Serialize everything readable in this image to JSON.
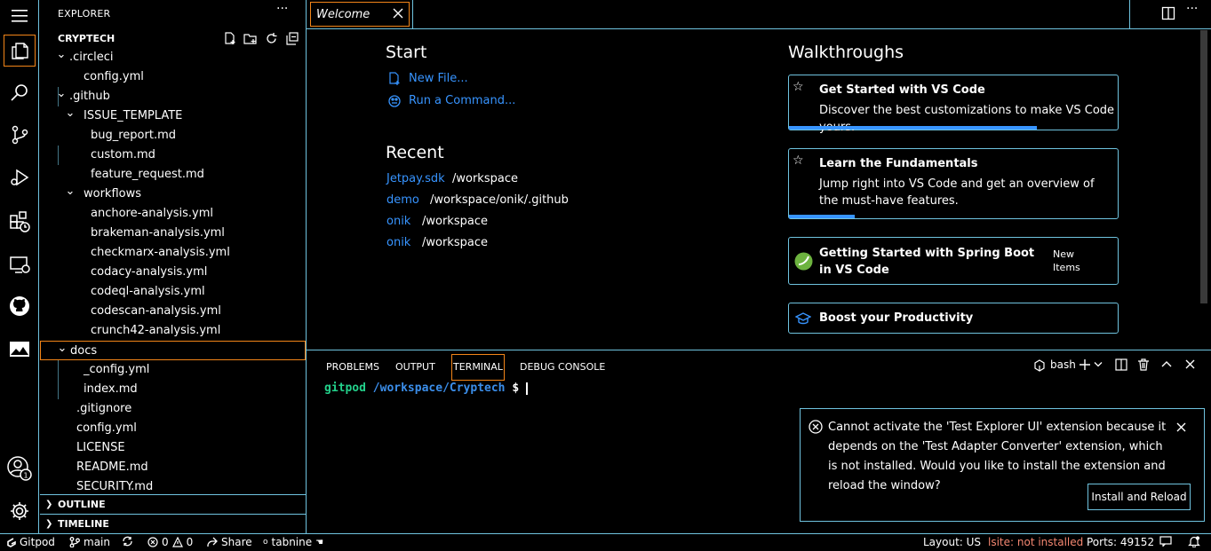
{
  "sidebar": {
    "title": "EXPLORER",
    "more": "···",
    "root": "CRYPTECH",
    "tree": [
      {
        "label": ".circleci",
        "type": "folder"
      },
      {
        "label": "config.yml",
        "type": "file"
      },
      {
        "label": ".github",
        "type": "folder"
      },
      {
        "label": "ISSUE_TEMPLATE",
        "type": "folder"
      },
      {
        "label": "bug_report.md",
        "type": "file"
      },
      {
        "label": "custom.md",
        "type": "file"
      },
      {
        "label": "feature_request.md",
        "type": "file"
      },
      {
        "label": "workflows",
        "type": "folder"
      },
      {
        "label": "anchore-analysis.yml",
        "type": "file"
      },
      {
        "label": "brakeman-analysis.yml",
        "type": "file"
      },
      {
        "label": "checkmarx-analysis.yml",
        "type": "file"
      },
      {
        "label": "codacy-analysis.yml",
        "type": "file"
      },
      {
        "label": "codeql-analysis.yml",
        "type": "file"
      },
      {
        "label": "codescan-analysis.yml",
        "type": "file"
      },
      {
        "label": "crunch42-analysis.yml",
        "type": "file"
      },
      {
        "label": "docs",
        "type": "folder"
      },
      {
        "label": "_config.yml",
        "type": "file"
      },
      {
        "label": "index.md",
        "type": "file"
      },
      {
        "label": ".gitignore",
        "type": "file"
      },
      {
        "label": "config.yml",
        "type": "file"
      },
      {
        "label": "LICENSE",
        "type": "file"
      },
      {
        "label": "README.md",
        "type": "file"
      },
      {
        "label": "SECURITY.md",
        "type": "file"
      }
    ],
    "outline": "OUTLINE",
    "timeline": "TIMELINE"
  },
  "editor": {
    "tab": "Welcome",
    "start_heading": "Start",
    "new_file": "New File...",
    "run_command": "Run a Command...",
    "recent_heading": "Recent",
    "recent": [
      {
        "name": "Jetpay.sdk",
        "path": "/workspace"
      },
      {
        "name": "demo",
        "path": "/workspace/onik/.github"
      },
      {
        "name": "onik",
        "path": "/workspace"
      },
      {
        "name": "onik",
        "path": "/workspace"
      }
    ],
    "walkthroughs_heading": "Walkthroughs",
    "cards": [
      {
        "title": "Get Started with VS Code",
        "desc": "Discover the best customizations to make VS Code yours.",
        "progress": 0.75
      },
      {
        "title": "Learn the Fundamentals",
        "desc": "Jump right into VS Code and get an overview of the must-have features.",
        "progress": 0.2
      },
      {
        "title": "Getting Started with Spring Boot in VS Code",
        "badge": "New Items"
      },
      {
        "title": "Boost your Productivity"
      }
    ]
  },
  "panel": {
    "tabs": [
      "PROBLEMS",
      "OUTPUT",
      "TERMINAL",
      "DEBUG CONSOLE"
    ],
    "shell": "bash",
    "prompt_user": "gitpod",
    "prompt_path": "/workspace/Cryptech",
    "prompt_symbol": "$"
  },
  "notification": {
    "message": "Cannot activate the 'Test Explorer UI' extension because it depends on the 'Test Adapter Converter' extension, which is not installed. Would you like to install the extension and reload the window?",
    "button": "Install and Reload"
  },
  "status": {
    "gitpod": "Gitpod",
    "branch": "main",
    "errors": "0",
    "warnings": "0",
    "share": "Share",
    "tabnine": "tabnine",
    "layout": "Layout: US",
    "lsp": "lsite: not installed",
    "ports": "Ports: 49152"
  },
  "colors": {
    "accent": "#6fc3df",
    "focus": "#f38518",
    "link": "#3794ff",
    "error": "#f48771",
    "term_green": "#23d18b"
  }
}
